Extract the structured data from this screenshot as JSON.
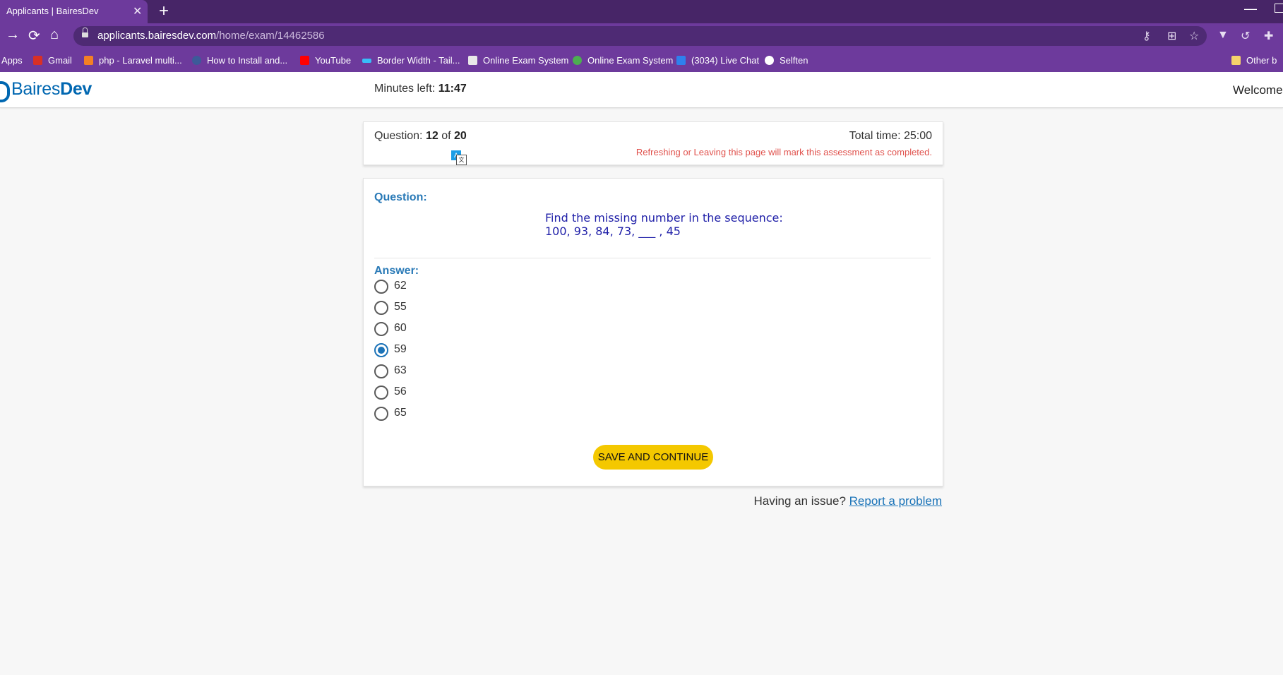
{
  "browser": {
    "tab_title": "Applicants | BairesDev",
    "tab_close": "✕",
    "new_tab": "+",
    "url_host": "applicants.bairesdev.com",
    "url_path": "/home/exam/14462586",
    "bookmarks": [
      {
        "label": "Apps",
        "icon_color": "#8ab4f8"
      },
      {
        "label": "Gmail",
        "icon_color": "#d93025"
      },
      {
        "label": "php - Laravel multi...",
        "icon_color": "#f48024"
      },
      {
        "label": "How to Install and...",
        "icon_color": "#3c5a99"
      },
      {
        "label": "YouTube",
        "icon_color": "#ff0000"
      },
      {
        "label": "Border Width - Tail...",
        "icon_color": "#38bdf8"
      },
      {
        "label": "Online Exam System",
        "icon_color": "#e8e8e8"
      },
      {
        "label": "Online Exam System",
        "icon_color": "#4caf50"
      },
      {
        "label": "(3034) Live Chat",
        "icon_color": "#2f80ed"
      },
      {
        "label": "Selften",
        "icon_color": "#ffffff"
      },
      {
        "label": "Other b",
        "icon_color": "#f5d36b"
      }
    ]
  },
  "header": {
    "logo_light": "Baires",
    "logo_bold": "Dev",
    "timer_label": "Minutes left:",
    "timer_value": "11:47",
    "welcome": "Welcome"
  },
  "progress": {
    "question_label": "Question:",
    "current": "12",
    "of": "of",
    "total": "20",
    "total_time": "Total time: 25:00",
    "warning": "Refreshing or Leaving this page will mark this assessment as completed."
  },
  "question": {
    "label": "Question:",
    "line1": "Find the missing number in the sequence:",
    "line2": "100, 93, 84, 73, ___ , 45"
  },
  "answer": {
    "label": "Answer:",
    "options": [
      "62",
      "55",
      "60",
      "59",
      "63",
      "56",
      "65"
    ],
    "selected": "59"
  },
  "save_button": "SAVE AND CONTINUE",
  "issue": {
    "text": "Having an issue?",
    "link": "Report a problem"
  },
  "colors": {
    "brand_blue": "#0067b1",
    "accent_purple": "#6d3a9c",
    "button_yellow": "#f4c800",
    "warning_red": "#e0524d"
  }
}
